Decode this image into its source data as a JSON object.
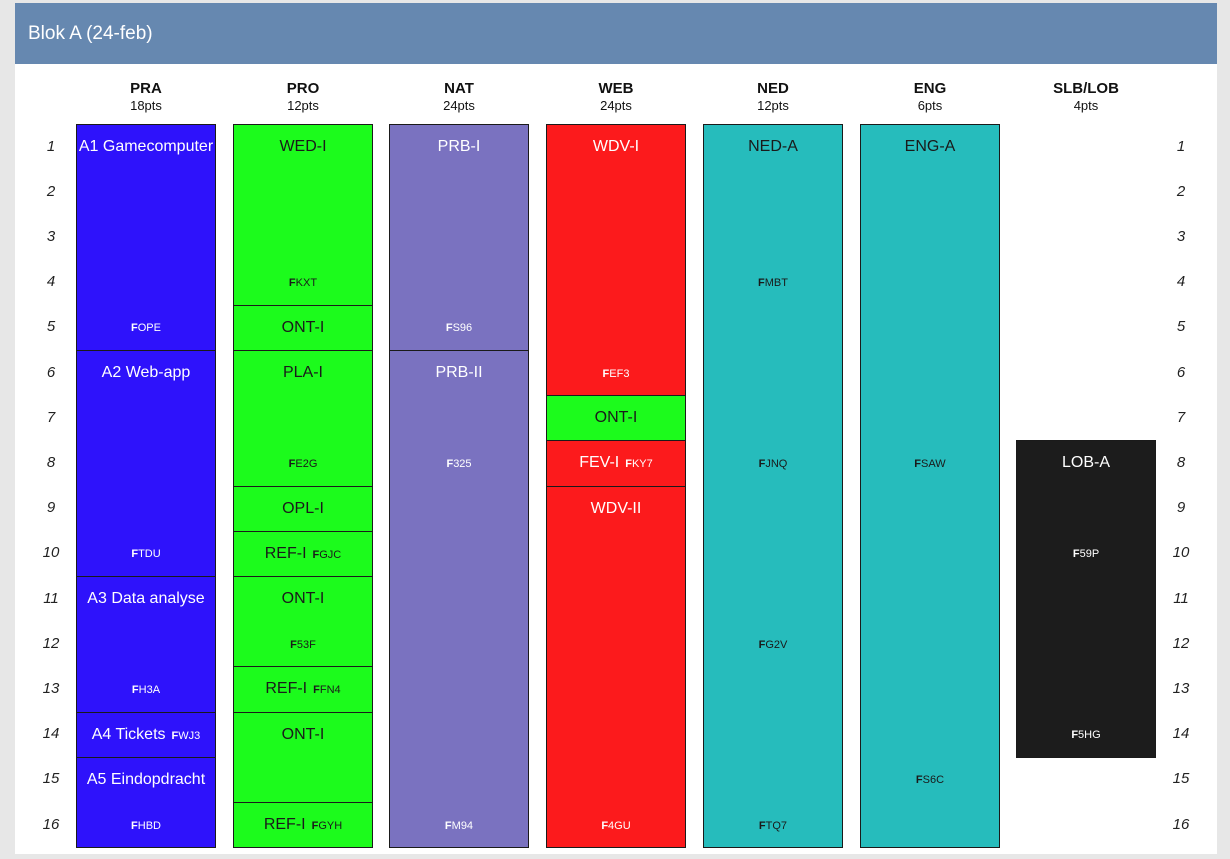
{
  "panel": {
    "title": "Blok A (24-feb)"
  },
  "columns": [
    {
      "name": "PRA",
      "pts": "18pts"
    },
    {
      "name": "PRO",
      "pts": "12pts"
    },
    {
      "name": "NAT",
      "pts": "24pts"
    },
    {
      "name": "WEB",
      "pts": "24pts"
    },
    {
      "name": "NED",
      "pts": "12pts"
    },
    {
      "name": "ENG",
      "pts": "6pts"
    },
    {
      "name": "SLB/LOB",
      "pts": "4pts"
    }
  ],
  "rows": [
    "1",
    "2",
    "3",
    "4",
    "5",
    "6",
    "7",
    "8",
    "9",
    "10",
    "11",
    "12",
    "13",
    "14",
    "15",
    "16"
  ],
  "blocks": [
    {
      "col": 0,
      "start": 1,
      "end": 5,
      "title": "A1 Gamecomputer",
      "code_prefix": "F",
      "code": "OPE",
      "code_row": 5,
      "color": "#2e12fb",
      "text": "light"
    },
    {
      "col": 0,
      "start": 6,
      "end": 10,
      "title": "A2 Web-app",
      "code_prefix": "F",
      "code": "TDU",
      "code_row": 10,
      "color": "#2e12fb",
      "text": "light"
    },
    {
      "col": 0,
      "start": 11,
      "end": 13,
      "title": "A3 Data analyse",
      "code_prefix": "F",
      "code": "H3A",
      "code_row": 13,
      "color": "#2e12fb",
      "text": "light"
    },
    {
      "col": 0,
      "start": 14,
      "end": 14,
      "title": "A4 Tickets",
      "code_prefix": "F",
      "code": "WJ3",
      "inline": true,
      "color": "#2e12fb",
      "text": "light"
    },
    {
      "col": 0,
      "start": 15,
      "end": 16,
      "title": "A5 Eindopdracht",
      "code_prefix": "F",
      "code": "HBD",
      "code_row": 16,
      "color": "#2e12fb",
      "text": "light"
    },
    {
      "col": 1,
      "start": 1,
      "end": 4,
      "title": "WED-I",
      "code_prefix": "F",
      "code": "KXT",
      "code_row": 4,
      "color": "#1cfb1c",
      "text": "dark"
    },
    {
      "col": 1,
      "start": 5,
      "end": 5,
      "title": "ONT-I",
      "color": "#1cfb1c",
      "text": "dark"
    },
    {
      "col": 1,
      "start": 6,
      "end": 8,
      "title": "PLA-I",
      "code_prefix": "F",
      "code": "E2G",
      "code_row": 8,
      "color": "#1cfb1c",
      "text": "dark"
    },
    {
      "col": 1,
      "start": 9,
      "end": 9,
      "title": "OPL-I",
      "color": "#1cfb1c",
      "text": "dark"
    },
    {
      "col": 1,
      "start": 10,
      "end": 10,
      "title": "REF-I",
      "code_prefix": "F",
      "code": "GJC",
      "inline": true,
      "color": "#1cfb1c",
      "text": "dark"
    },
    {
      "col": 1,
      "start": 11,
      "end": 12,
      "title": "ONT-I",
      "code_prefix": "F",
      "code": "53F",
      "code_row": 12,
      "color": "#1cfb1c",
      "text": "dark"
    },
    {
      "col": 1,
      "start": 13,
      "end": 13,
      "title": "REF-I",
      "code_prefix": "F",
      "code": "FN4",
      "inline": true,
      "color": "#1cfb1c",
      "text": "dark"
    },
    {
      "col": 1,
      "start": 14,
      "end": 15,
      "title": "ONT-I",
      "color": "#1cfb1c",
      "text": "dark"
    },
    {
      "col": 1,
      "start": 16,
      "end": 16,
      "title": "REF-I",
      "code_prefix": "F",
      "code": "GYH",
      "inline": true,
      "color": "#1cfb1c",
      "text": "dark"
    },
    {
      "col": 2,
      "start": 1,
      "end": 5,
      "title": "PRB-I",
      "code_prefix": "F",
      "code": "S96",
      "code_row": 5,
      "color": "#7a72c0",
      "text": "light"
    },
    {
      "col": 2,
      "start": 6,
      "end": 16,
      "title": "PRB-II",
      "code_prefix": "F",
      "code": "325",
      "code_row": 8,
      "code2_prefix": "F",
      "code2": "M94",
      "code2_row": 16,
      "color": "#7a72c0",
      "text": "light"
    },
    {
      "col": 3,
      "start": 1,
      "end": 6,
      "title": "WDV-I",
      "code_prefix": "F",
      "code": "EF3",
      "code_row": 6,
      "color": "#fc1a1c",
      "text": "light"
    },
    {
      "col": 3,
      "start": 7,
      "end": 7,
      "title": "ONT-I",
      "color": "#1cfb1c",
      "text": "dark"
    },
    {
      "col": 3,
      "start": 8,
      "end": 8,
      "title": "FEV-I",
      "code_prefix": "F",
      "code": "KY7",
      "inline": true,
      "color": "#fc1a1c",
      "text": "light"
    },
    {
      "col": 3,
      "start": 9,
      "end": 16,
      "title": "WDV-II",
      "code_prefix": "F",
      "code": "4GU",
      "code_row": 16,
      "color": "#fc1a1c",
      "text": "light"
    },
    {
      "col": 4,
      "start": 1,
      "end": 16,
      "title": "NED-A",
      "code_prefix": "F",
      "code": "MBT",
      "code_row": 4,
      "code2_prefix": "F",
      "code2": "JNQ",
      "code2_row": 8,
      "code3_prefix": "F",
      "code3": "G2V",
      "code3_row": 12,
      "code4_prefix": "F",
      "code4": "TQ7",
      "code4_row": 16,
      "color": "#26bcbc",
      "text": "dark"
    },
    {
      "col": 5,
      "start": 1,
      "end": 16,
      "title": "ENG-A",
      "code_prefix": "F",
      "code": "SAW",
      "code_row": 8,
      "code2_prefix": "F",
      "code2": "S6C",
      "code2_row": 15,
      "color": "#26bcbc",
      "text": "dark"
    },
    {
      "col": 6,
      "start": 8,
      "end": 14,
      "title": "LOB-A",
      "code_prefix": "F",
      "code": "59P",
      "code_row": 10,
      "code2_prefix": "F",
      "code2": "5HG",
      "code2_row": 14,
      "color": "#1c1c1c",
      "text": "light"
    }
  ]
}
